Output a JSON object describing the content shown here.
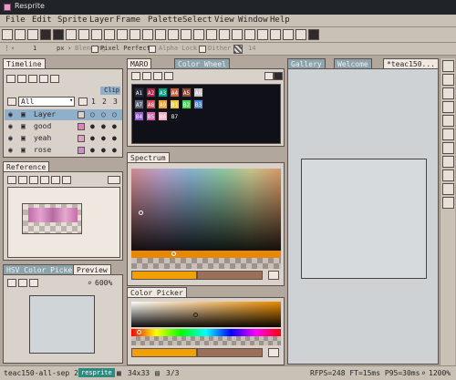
{
  "window": {
    "title": "Resprite"
  },
  "menu": [
    "File",
    "Edit",
    "Sprite",
    "Layer",
    "Frame",
    "Palette",
    "Select",
    "View",
    "Window",
    "Help"
  ],
  "options": {
    "px_value": "1",
    "px_unit": "px",
    "blending": "Blending",
    "pixel_perfect": "Pixel Perfect",
    "alpha_lock": "Alpha Lock",
    "dither": "Dither",
    "dither_value": "14"
  },
  "timeline": {
    "tab": "Timeline",
    "clip": "Clip",
    "filter": "All",
    "frames": [
      "1",
      "2",
      "3"
    ],
    "layers": [
      {
        "name": "Layer",
        "selected": true
      },
      {
        "name": "good",
        "selected": false
      },
      {
        "name": "yeah",
        "selected": false
      },
      {
        "name": "rose",
        "selected": false
      }
    ]
  },
  "reference": {
    "tab": "Reference"
  },
  "hsv_picker": {
    "tab": "HSV Color Picker"
  },
  "preview": {
    "tab": "Preview",
    "zoom": "600%"
  },
  "palette": {
    "tab": "MARO",
    "alt_tab": "Color Wheel",
    "swatches": [
      {
        "label": "A1",
        "color": "#101018"
      },
      {
        "label": "A2",
        "color": "#262840"
      },
      {
        "label": "A3",
        "color": "#b0204c"
      },
      {
        "label": "A4",
        "color": "#109a86"
      },
      {
        "label": "A5",
        "color": "#d0603a"
      },
      {
        "label": "A6",
        "color": "#8c4a3a"
      },
      {
        "label": "A7",
        "color": "#c8c4cc"
      },
      {
        "label": "A8",
        "color": "#606878"
      },
      {
        "label": "A9",
        "color": "#e04860"
      },
      {
        "label": "B1",
        "color": "#e8a838"
      },
      {
        "label": "B2",
        "color": "#f0cc2c"
      },
      {
        "label": "B3",
        "color": "#50d060"
      },
      {
        "label": "B4",
        "color": "#4c8ae0"
      },
      {
        "label": "B5",
        "color": "#9460c8"
      },
      {
        "label": "B6",
        "color": "#e060b0"
      },
      {
        "label": "B7",
        "color": "#f0b0c0"
      }
    ]
  },
  "spectrum": {
    "tab": "Spectrum"
  },
  "color_picker": {
    "tab": "Color Picker"
  },
  "editor": {
    "tabs": [
      "Gallery",
      "Welcome",
      "*teac150..."
    ]
  },
  "status": {
    "file": "teac150-all-sep 2",
    "badge": "resprite",
    "size": "34x33",
    "frame": "3/3",
    "stats": "RFPS=248 FT=15ms P95=30ms",
    "zoom": "1200%"
  },
  "colors": {
    "accent": "#8fb0c8",
    "primary": "#f0a000",
    "secondary": "#9b6f58"
  }
}
